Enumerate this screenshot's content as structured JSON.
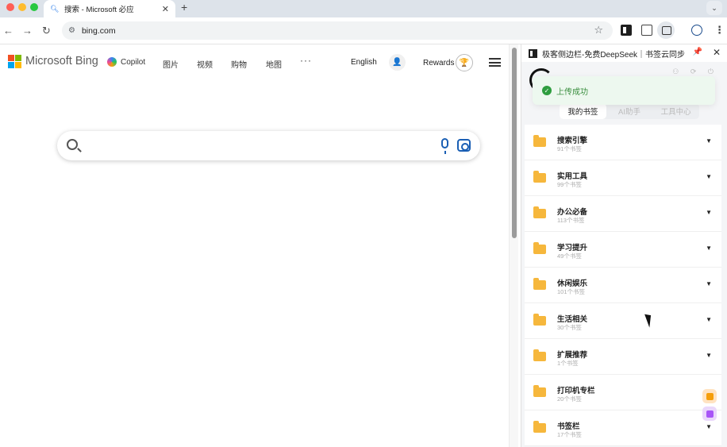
{
  "browser": {
    "tab": {
      "favicon": "search-icon",
      "title": "搜索 - Microsoft 必应",
      "close": "✕"
    },
    "new_tab": "+",
    "tab_menu": "⌄",
    "nav": {
      "back": "←",
      "forward": "→",
      "reload": "↻"
    },
    "address": {
      "site_icon": "⚙",
      "url": "bing.com",
      "bookmark": "☆"
    },
    "menu": "⋮"
  },
  "bing": {
    "brand": "Microsoft Bing",
    "logo_colors": [
      "#f25022",
      "#7fba00",
      "#00a4ef",
      "#ffb900"
    ],
    "copilot": "Copilot",
    "nav_links": [
      "图片",
      "视频",
      "购物",
      "地图"
    ],
    "more": "···",
    "language": "English",
    "user_glyph": "👤",
    "rewards": "Rewards",
    "trophy_glyph": "🏆",
    "search": {
      "placeholder": ""
    }
  },
  "panel": {
    "title": "极客侧边栏-免费DeepSeek｜书签云同步",
    "pin": "📌",
    "close": "✕",
    "header_icons": "⚇ ⟳ ⏻",
    "toast": {
      "icon": "✓",
      "text": "上传成功"
    },
    "tabs": [
      "我的书签",
      "AI助手",
      "工具中心"
    ],
    "bookmarks": [
      {
        "name": "搜索引擎",
        "count": "91个书签"
      },
      {
        "name": "实用工具",
        "count": "99个书签"
      },
      {
        "name": "办公必备",
        "count": "113个书签"
      },
      {
        "name": "学习提升",
        "count": "49个书签"
      },
      {
        "name": "休闲娱乐",
        "count": "101个书签"
      },
      {
        "name": "生活相关",
        "count": "30个书签"
      },
      {
        "name": "扩展推荐",
        "count": "1个书签"
      },
      {
        "name": "打印机专栏",
        "count": "20个书签"
      },
      {
        "name": "书签栏",
        "count": "17个书签"
      }
    ],
    "caret": "▼"
  }
}
